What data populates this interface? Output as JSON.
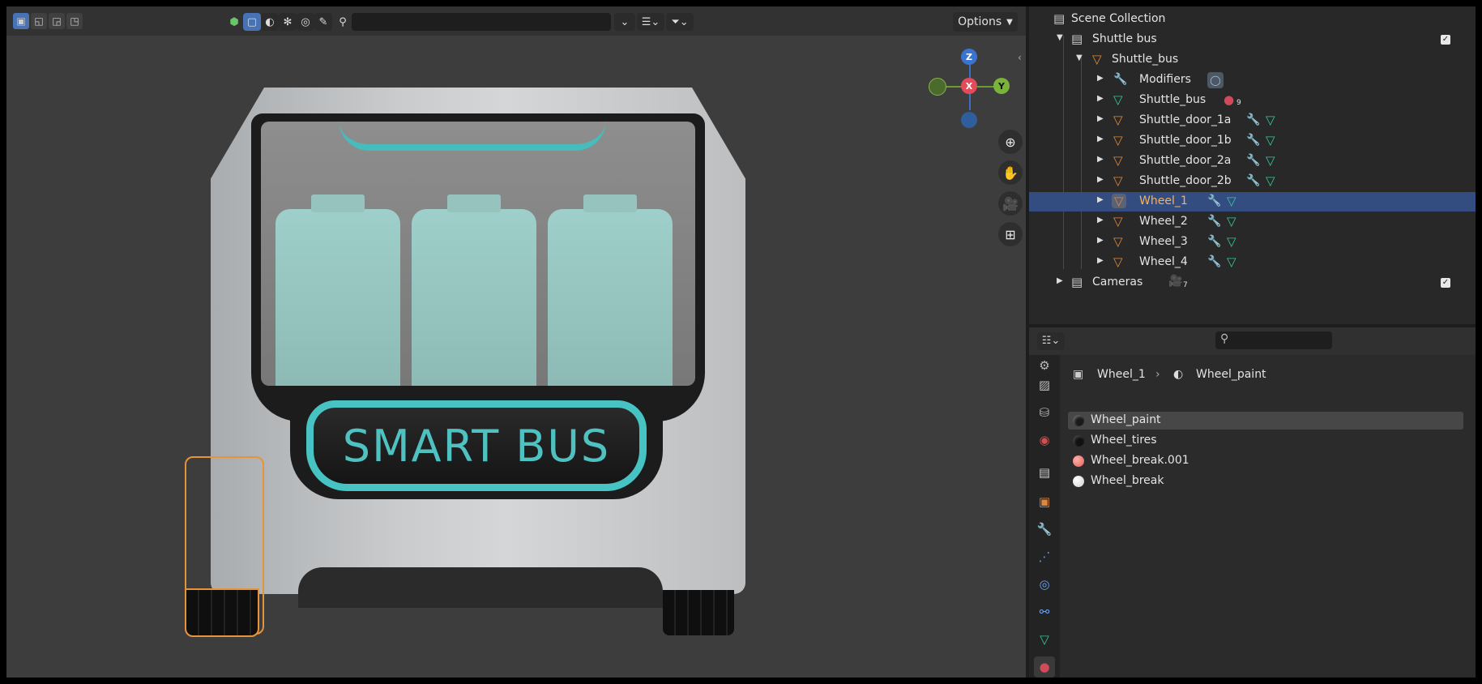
{
  "viewport": {
    "select_modes": [
      "select-new",
      "select-extend",
      "select-subtract",
      "select-intersect"
    ],
    "header_icons": [
      "object-type-icon",
      "shading-solid-icon",
      "shading-material-icon",
      "shading-render-icon",
      "overlay-icon",
      "brush-icon"
    ],
    "search": {
      "value": "",
      "placeholder": ""
    },
    "options_label": "Options",
    "gizmo": {
      "z": "Z",
      "x": "X",
      "y": "Y"
    },
    "model_sign_text": "SMART BUS"
  },
  "outliner": {
    "rows": [
      {
        "label": "Scene Collection",
        "icon": "collection-icon"
      },
      {
        "label": "Shuttle bus",
        "icon": "collection-icon",
        "checked": true
      },
      {
        "label": "Shuttle_bus",
        "icon": "mesh-object-icon"
      },
      {
        "label": "Modifiers",
        "icon": "wrench-icon"
      },
      {
        "label": "Shuttle_bus",
        "icon": "mesh-data-icon",
        "badge": "9"
      },
      {
        "label": "Shuttle_door_1a",
        "icon": "mesh-object-icon"
      },
      {
        "label": "Shuttle_door_1b",
        "icon": "mesh-object-icon"
      },
      {
        "label": "Shuttle_door_2a",
        "icon": "mesh-object-icon"
      },
      {
        "label": "Shuttle_door_2b",
        "icon": "mesh-object-icon"
      },
      {
        "label": "Wheel_1",
        "icon": "mesh-object-icon",
        "selected": true
      },
      {
        "label": "Wheel_2",
        "icon": "mesh-object-icon"
      },
      {
        "label": "Wheel_3",
        "icon": "mesh-object-icon"
      },
      {
        "label": "Wheel_4",
        "icon": "mesh-object-icon"
      },
      {
        "label": "Cameras",
        "icon": "collection-icon",
        "badge": "7",
        "checked": true
      }
    ]
  },
  "properties": {
    "breadcrumb": {
      "object": "Wheel_1",
      "material": "Wheel_paint"
    },
    "materials": [
      {
        "label": "Wheel_paint",
        "color": "#1a1a1a",
        "active": true
      },
      {
        "label": "Wheel_tires",
        "color": "#111111"
      },
      {
        "label": "Wheel_break.001",
        "color": "#e0605a"
      },
      {
        "label": "Wheel_break",
        "color": "#f2f2f2"
      }
    ]
  },
  "colors": {
    "selection": "#334d80",
    "accent": "#4772b3",
    "object_orange": "#e79338",
    "teal": "#4fc1c1"
  }
}
